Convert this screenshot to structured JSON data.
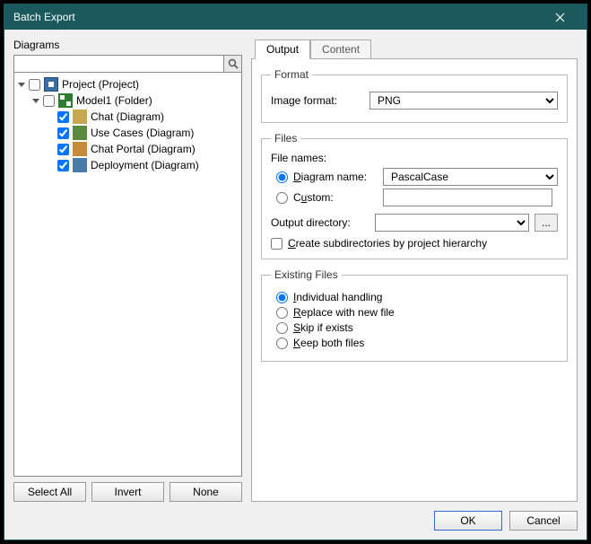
{
  "title": "Batch Export",
  "left": {
    "header": "Diagrams",
    "search_placeholder": "",
    "tree": {
      "project": "Project (Project)",
      "folder": "Model1 (Folder)",
      "items": [
        "Chat (Diagram)",
        "Use Cases (Diagram)",
        "Chat Portal (Diagram)",
        "Deployment (Diagram)"
      ]
    },
    "buttons": {
      "select_all": "Select All",
      "invert": "Invert",
      "none": "None"
    }
  },
  "tabs": {
    "output": "Output",
    "content": "Content"
  },
  "format": {
    "legend": "Format",
    "image_format_label": "Image format:",
    "image_format_value": "PNG"
  },
  "files": {
    "legend": "Files",
    "file_names_label": "File names:",
    "diagram_name_label": "Diagram name:",
    "diagram_name_value": "PascalCase",
    "custom_label": "Custom:",
    "custom_value": "",
    "output_dir_label": "Output directory:",
    "output_dir_value": "",
    "browse": "...",
    "create_subdirs": "Create subdirectories by project hierarchy"
  },
  "existing": {
    "legend": "Existing Files",
    "individual": "Individual handling",
    "replace": "Replace with new file",
    "skip": "Skip if exists",
    "keep": "Keep both files"
  },
  "footer": {
    "ok": "OK",
    "cancel": "Cancel"
  }
}
